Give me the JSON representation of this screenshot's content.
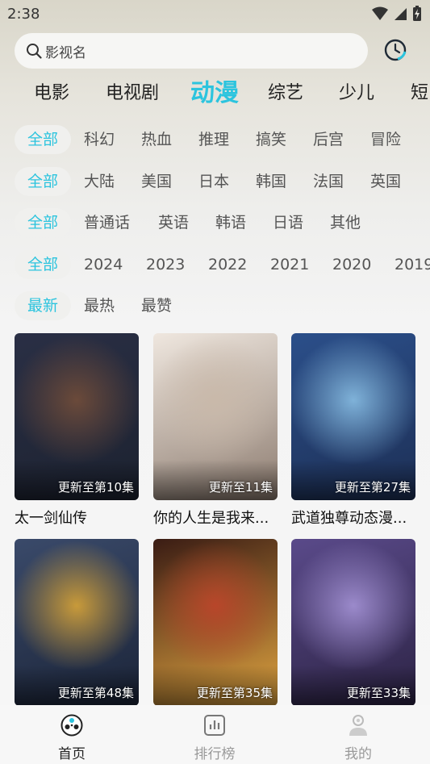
{
  "status_bar": {
    "time": "2:38"
  },
  "search": {
    "placeholder": "影视名"
  },
  "category_tabs": [
    {
      "label": "电影"
    },
    {
      "label": "电视剧"
    },
    {
      "label": "动漫"
    },
    {
      "label": "综艺"
    },
    {
      "label": "少儿"
    },
    {
      "label": "短"
    }
  ],
  "filters": {
    "genre": [
      "全部",
      "科幻",
      "热血",
      "推理",
      "搞笑",
      "后宫",
      "冒险"
    ],
    "region": [
      "全部",
      "大陆",
      "美国",
      "日本",
      "韩国",
      "法国",
      "英国"
    ],
    "language": [
      "全部",
      "普通话",
      "英语",
      "韩语",
      "日语",
      "其他"
    ],
    "year": [
      "全部",
      "2024",
      "2023",
      "2022",
      "2021",
      "2020",
      "2019"
    ],
    "sort": [
      "最新",
      "最热",
      "最赞"
    ]
  },
  "cards": [
    {
      "title": "太一剑仙传",
      "badge": "更新至第10集"
    },
    {
      "title": "你的人生是我来...",
      "badge": "更新至11集"
    },
    {
      "title": "武道独尊动态漫...",
      "badge": "更新至第27集"
    },
    {
      "title": "",
      "badge": "更新至第48集"
    },
    {
      "title": "",
      "badge": "更新至第35集"
    },
    {
      "title": "",
      "badge": "更新至33集"
    }
  ],
  "poster_art": [
    {
      "colors": [
        "#2a2f45",
        "#6b4a3a",
        "#1c2230"
      ]
    },
    {
      "colors": [
        "#efe7df",
        "#c9b9aa",
        "#8d7c70"
      ]
    },
    {
      "colors": [
        "#2b4f8a",
        "#7fb2d9",
        "#1d2f55"
      ]
    },
    {
      "colors": [
        "#3a4a6a",
        "#c89a3a",
        "#1b2438"
      ]
    },
    {
      "colors": [
        "#3a1c14",
        "#b8462a",
        "#e0a440"
      ]
    },
    {
      "colors": [
        "#5a4a8a",
        "#9b8acb",
        "#2c2344"
      ]
    }
  ],
  "bottom_nav": [
    {
      "label": "首页",
      "icon": "home-film-reel-icon",
      "active": true
    },
    {
      "label": "排行榜",
      "icon": "ranking-chart-icon",
      "active": false
    },
    {
      "label": "我的",
      "icon": "profile-icon",
      "active": false
    }
  ],
  "colors": {
    "accent": "#2cc4de",
    "text": "#222222",
    "muted": "#999999"
  }
}
